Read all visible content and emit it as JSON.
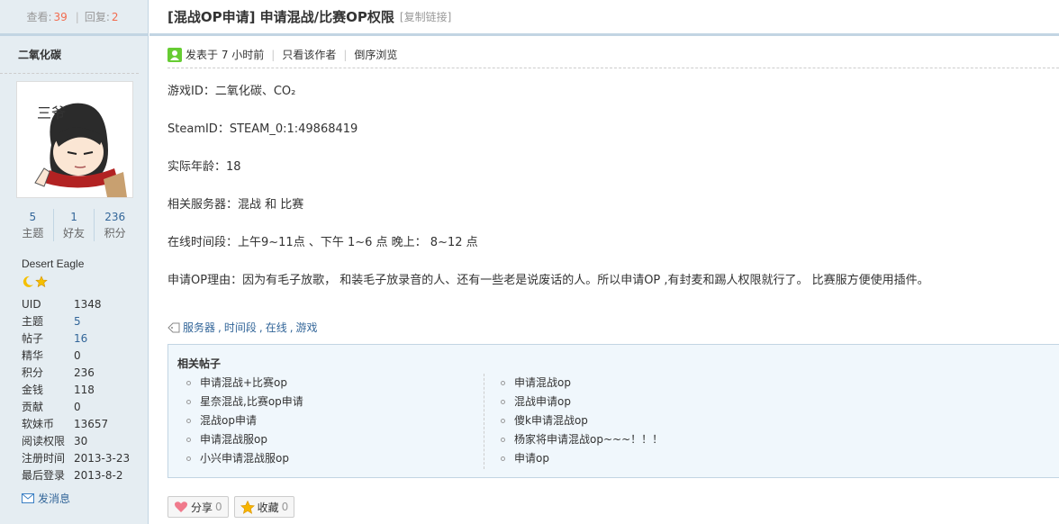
{
  "stats": {
    "views_label": "查看:",
    "views": "39",
    "replies_label": "回复:",
    "replies": "2"
  },
  "author": {
    "name": "二氧化碳",
    "counts": [
      {
        "value": "5",
        "label": "主题"
      },
      {
        "value": "1",
        "label": "好友"
      },
      {
        "value": "236",
        "label": "积分"
      }
    ],
    "group": "Desert Eagle",
    "info": [
      {
        "key": "UID",
        "value": "1348",
        "link": false
      },
      {
        "key": "主题",
        "value": "5",
        "link": true
      },
      {
        "key": "帖子",
        "value": "16",
        "link": true
      },
      {
        "key": "精华",
        "value": "0",
        "link": false
      },
      {
        "key": "积分",
        "value": "236",
        "link": false
      },
      {
        "key": "金钱",
        "value": "118",
        "link": false
      },
      {
        "key": "贡献",
        "value": "0",
        "link": false
      },
      {
        "key": "软妹币",
        "value": "13657",
        "link": false
      },
      {
        "key": "阅读权限",
        "value": "30",
        "link": false
      },
      {
        "key": "注册时间",
        "value": "2013-3-23",
        "link": false
      },
      {
        "key": "最后登录",
        "value": "2013-8-2",
        "link": false
      }
    ],
    "pm_label": "发消息"
  },
  "thread": {
    "title": "[混战OP申请] 申请混战/比赛OP权限",
    "copy_link": "[复制链接]",
    "posted": "发表于 7 小时前",
    "only_author": "只看该作者",
    "reverse": "倒序浏览"
  },
  "content": [
    "游戏ID：二氧化碳、CO₂",
    "SteamID：STEAM_0:1:49868419",
    "实际年龄：18",
    "相关服务器：混战 和 比赛",
    "在线时间段：上午9~11点 、下午 1~6 点  晚上： 8~12 点",
    "申请OP理由：因为有毛子放歌， 和装毛子放录音的人、还有一些老是说废话的人。所以申请OP ,有封麦和踢人权限就行了。 比赛服方便使用插件。"
  ],
  "tags": [
    "服务器",
    "时间段",
    "在线",
    "游戏"
  ],
  "related": {
    "title": "相关帖子",
    "left": [
      "申请混战+比赛op",
      "星奈混战,比赛op申请",
      "混战op申请",
      "申请混战服op",
      "小兴申请混战服op"
    ],
    "right": [
      "申请混战op",
      "混战申请op",
      "傻k申请混战op",
      "杨家将申请混战op~~~！！！",
      "申请op"
    ]
  },
  "actions": {
    "share_label": "分享",
    "share_count": "0",
    "fav_label": "收藏",
    "fav_count": "0"
  },
  "colors": {
    "accent": "#336699",
    "border": "#c2d5e3",
    "sidebar": "#e5edf2",
    "highlight": "#f26c4f"
  }
}
